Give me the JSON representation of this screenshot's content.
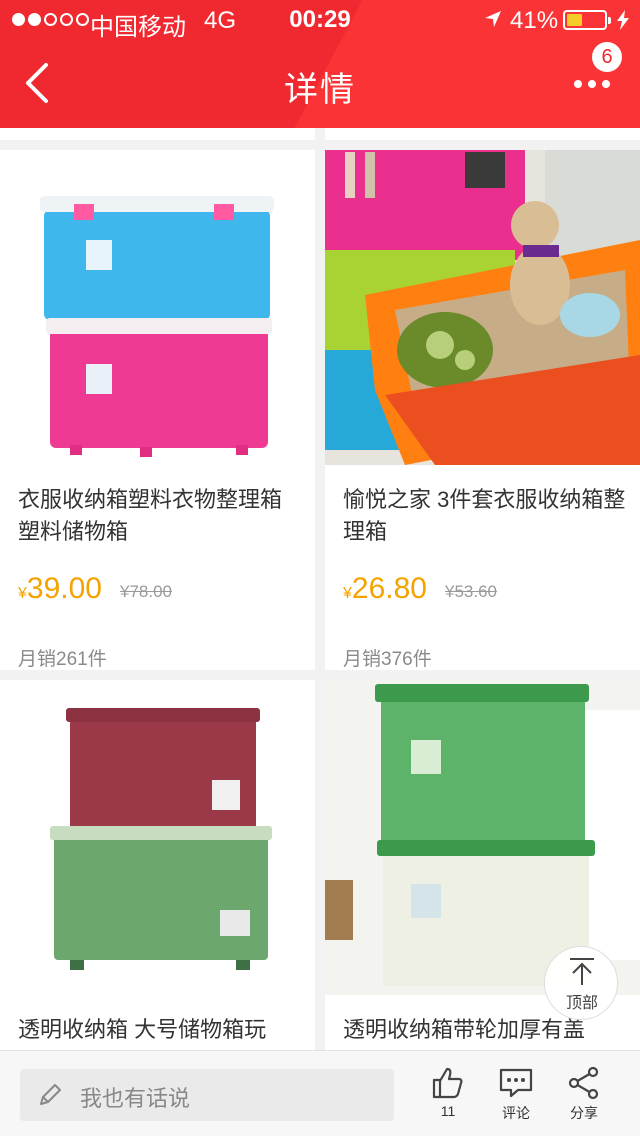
{
  "status_bar": {
    "carrier": "中国移动",
    "network": "4G",
    "time": "00:29",
    "battery_percent": "41%",
    "battery_level": 0.41
  },
  "nav": {
    "title": "详情",
    "badge_count": "6",
    "back_icon": "chevron-left-icon",
    "more_icon": "more-dots-icon"
  },
  "products": [
    {
      "title": "衣服收纳箱塑料衣物整理箱塑料储物箱",
      "price_symbol": "¥",
      "price": "39.00",
      "original_price": "¥78.00",
      "sales": "月销261件"
    },
    {
      "title": "愉悦之家 3件套衣服收纳箱整理箱",
      "price_symbol": "¥",
      "price": "26.80",
      "original_price": "¥53.60",
      "sales": "月销376件"
    },
    {
      "title": "透明收纳箱 大号储物箱玩",
      "price_symbol": "¥",
      "price": "",
      "original_price": "",
      "sales": ""
    },
    {
      "title": "透明收纳箱带轮加厚有盖",
      "price_symbol": "¥",
      "price": "",
      "original_price": "",
      "sales": ""
    }
  ],
  "back_to_top": {
    "label": "顶部"
  },
  "bottom_bar": {
    "comment_placeholder": "我也有话说",
    "like_count": "11",
    "comment_label": "评论",
    "share_label": "分享"
  },
  "colors": {
    "brand_red": "#f0282f",
    "price_orange": "#f5a300"
  }
}
